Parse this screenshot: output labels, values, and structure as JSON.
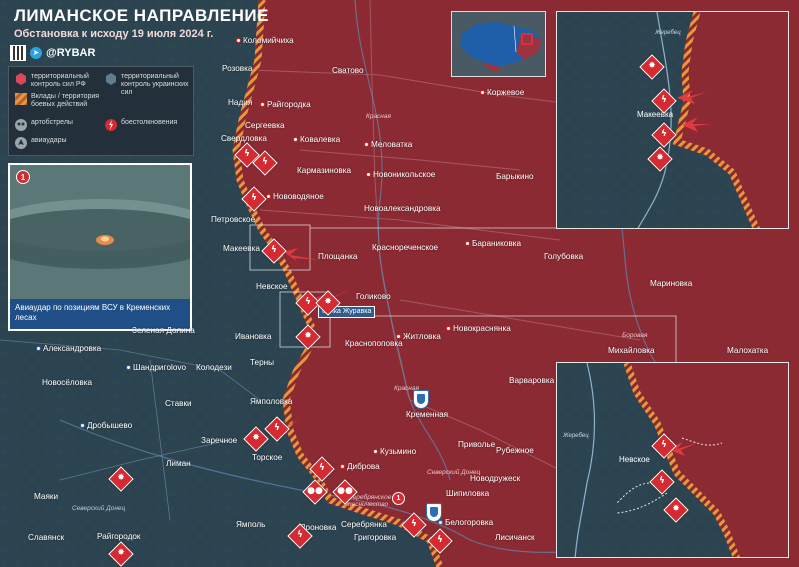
{
  "header": {
    "title": "ЛИМАНСКОЕ НАПРАВЛЕНИЕ",
    "subtitle": "Обстановка к исходу 19 июля 2024 г."
  },
  "brand": {
    "name": "@RYBAR",
    "watermark": "RYBAR"
  },
  "legend": {
    "ru_control": "территориальный контроль сил РФ",
    "ua_control": "территориальный контроль украинских сил",
    "contested": "Вклады / территория боевых действий",
    "shelling": "артобстрелы",
    "clashes": "боестолкновения",
    "airstrikes": "авиаудары"
  },
  "photo": {
    "number": "1",
    "caption": "Авиаудар по позициям ВСУ в Кременских лесах"
  },
  "colors": {
    "ru_territory": "#8c2a33",
    "ua_territory": "#2c4452",
    "event_marker": "#d42a31",
    "front_line": "#e59a3a",
    "ua_marker": "#2c6fb0"
  },
  "places": [
    {
      "id": "kolomiychikha",
      "name": "Коломийчиха",
      "side": "ru"
    },
    {
      "id": "rozovka",
      "name": "Розовка",
      "side": "ru"
    },
    {
      "id": "nadiya",
      "name": "Надия",
      "side": "ru"
    },
    {
      "id": "raigorodka",
      "name": "Райгородка",
      "side": "ru"
    },
    {
      "id": "sergeevka",
      "name": "Сергеевка",
      "side": "ru"
    },
    {
      "id": "svatovo",
      "name": "Сватово",
      "side": "ru"
    },
    {
      "id": "korzhevoe",
      "name": "Коржевое",
      "side": "ru"
    },
    {
      "id": "svердlovka",
      "name": "Свердловка",
      "side": "ru"
    },
    {
      "id": "kovalevka",
      "name": "Ковалевка",
      "side": "ru"
    },
    {
      "id": "melovatka",
      "name": "Меловатка",
      "side": "ru"
    },
    {
      "id": "karmazinovka",
      "name": "Кармазиновка",
      "side": "ru"
    },
    {
      "id": "novonikolskoe",
      "name": "Новоникольское",
      "side": "ru"
    },
    {
      "id": "barykino",
      "name": "Барыкино",
      "side": "ru"
    },
    {
      "id": "novovodyanoe",
      "name": "Нововодяное",
      "side": "ru"
    },
    {
      "id": "novoaleksandrovka",
      "name": "Новоалександровка",
      "side": "ru"
    },
    {
      "id": "petrovskoe",
      "name": "Петровское",
      "side": "ru"
    },
    {
      "id": "makeevka",
      "name": "Макеевка",
      "side": "ru"
    },
    {
      "id": "krasnorechenskoe",
      "name": "Краснореченское",
      "side": "ru"
    },
    {
      "id": "baranikovka",
      "name": "Бараниковка",
      "side": "ru"
    },
    {
      "id": "goluvbovka",
      "name": "Голубовка",
      "side": "ru"
    },
    {
      "id": "ploshchanka",
      "name": "Площанка",
      "side": "ru"
    },
    {
      "id": "nevskoe",
      "name": "Невское",
      "side": "ru"
    },
    {
      "id": "golikovo",
      "name": "Голиково",
      "side": "ru"
    },
    {
      "id": "marinovka",
      "name": "Мариновка",
      "side": "ru"
    },
    {
      "id": "novokrasnyanka",
      "name": "Новокраснянка",
      "side": "ru"
    },
    {
      "id": "ivanovka",
      "name": "Ивановка",
      "side": "ua"
    },
    {
      "id": "krasnopopovka",
      "name": "Краснопоповка",
      "side": "ru"
    },
    {
      "id": "zhitlovka",
      "name": "Житловка",
      "side": "ru"
    },
    {
      "id": "mikhailovka",
      "name": "Михайловка",
      "side": "ru"
    },
    {
      "id": "malokhatka",
      "name": "Малохатка",
      "side": "ru"
    },
    {
      "id": "zelenaya_dolina",
      "name": "Зеленая Долина",
      "side": "ua"
    },
    {
      "id": "aleksandrovka",
      "name": "Александровка",
      "side": "ua"
    },
    {
      "id": "shandrigolovo",
      "name": "Шандригolovo",
      "side": "ua"
    },
    {
      "id": "kolodezi",
      "name": "Колодези",
      "side": "ua"
    },
    {
      "id": "terny",
      "name": "Терны",
      "side": "ua"
    },
    {
      "id": "novoselovka",
      "name": "Новосёловка",
      "side": "ua"
    },
    {
      "id": "stavki",
      "name": "Ставки",
      "side": "ua"
    },
    {
      "id": "yampolovka",
      "name": "Ямполовка",
      "side": "ua"
    },
    {
      "id": "varvarovka",
      "name": "Варваровка",
      "side": "ru"
    },
    {
      "id": "drobyshevo",
      "name": "Дробышево",
      "side": "ua"
    },
    {
      "id": "kremennaya",
      "name": "Кременная",
      "side": "ru"
    },
    {
      "id": "zarechnoe",
      "name": "Заречное",
      "side": "ua"
    },
    {
      "id": "privolye",
      "name": "Приволье",
      "side": "ru"
    },
    {
      "id": "rubezhnoe",
      "name": "Рубежное",
      "side": "ru"
    },
    {
      "id": "liman",
      "name": "Лиман",
      "side": "ua"
    },
    {
      "id": "torskoe",
      "name": "Торское",
      "side": "ua"
    },
    {
      "id": "diprova",
      "name": "Диброва",
      "side": "ru"
    },
    {
      "id": "kuzmino",
      "name": "Кузьмино",
      "side": "ru"
    },
    {
      "id": "novodruzhesk",
      "name": "Новодружеск",
      "side": "ru"
    },
    {
      "id": "shipilovka",
      "name": "Шипиловка",
      "side": "ru"
    },
    {
      "id": "mayaki",
      "name": "Маяки",
      "side": "ua"
    },
    {
      "id": "raigorodok",
      "name": "Райгородок",
      "side": "ua"
    },
    {
      "id": "yampol",
      "name": "Ямполь",
      "side": "ua"
    },
    {
      "id": "dronovka",
      "name": "Дроновка",
      "side": "ua"
    },
    {
      "id": "serebryanka",
      "name": "Серебрянка",
      "side": "ua"
    },
    {
      "id": "belogorovka",
      "name": "Белогоровка",
      "side": "ua"
    },
    {
      "id": "slavyansk",
      "name": "Славянск",
      "side": "ua"
    },
    {
      "id": "grigorovka",
      "name": "Григоровка",
      "side": "ua"
    },
    {
      "id": "lisichansk",
      "name": "Лисичанск",
      "side": "ru"
    }
  ],
  "rivers": {
    "krasnaya": "Красная",
    "krasnaya2": "Красная",
    "borovaya": "Боровая",
    "seversky_donets": "Северский Донец",
    "seversky_donets2": "Северский Донец",
    "serebryanskoe": "Серебрянское лесничество",
    "zherebets": "Жеребец"
  },
  "callout": {
    "balka": "балка Журавка"
  },
  "insets": {
    "top": {
      "city": "Макеевка",
      "river": "Жеребец"
    },
    "bottom": {
      "city": "Невское",
      "river": "Жеребец"
    }
  },
  "badges": {
    "photo_ref": "1",
    "map_ref": "1"
  }
}
